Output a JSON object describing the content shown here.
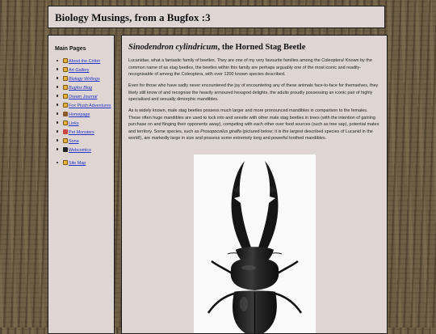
{
  "header": {
    "title": "Biology Musings, from a Bugfox :3"
  },
  "sidebar": {
    "heading": "Main Pages",
    "items": [
      {
        "label": "About the Critter",
        "icon": "bugfox-icon"
      },
      {
        "label": "Art Gallery",
        "icon": "bugfox-icon"
      },
      {
        "label": "Biology Writings",
        "icon": "bugfox-icon"
      },
      {
        "label": "Bugfox Blog",
        "icon": "bugfox-icon"
      },
      {
        "label": "Dream Journal",
        "icon": "bugfox-icon"
      },
      {
        "label": "Fox Plush Adventures",
        "icon": "bugfox-icon"
      },
      {
        "label": "Homepage",
        "icon": "house-icon"
      },
      {
        "label": "Links",
        "icon": "bugfox-icon"
      },
      {
        "label": "Pet Monsters",
        "icon": "pet-icon"
      },
      {
        "label": "Sona",
        "icon": "bugfox-icon"
      },
      {
        "label": "Webcomics",
        "icon": "comic-icon"
      }
    ],
    "sitemap_label": "Site Map"
  },
  "article": {
    "title_italic": "Sinodendron cylindricum",
    "title_rest": ", the Horned Stag Beetle",
    "p1": "Lucanidae, what a fantastic family of beetles. They are one of my very favourite families among the Coleoptera! Known by the common name of as stag beetles, the beetles within this family are perhaps arguably one of the most iconic and readily-recognisable of among the Coleoptera, with over 1200 known species described.",
    "p2": "Even for those who have sadly never encountered the joy of encountering any of these animals face-to-face for themselves, they likely still know of and recognise the heavily armoured hexapod delights, the adults proudly possessing an iconic pair of highly specialised and sexually dimorphic mandibles.",
    "p3_a": "As is widely known, male stag beetles possess much larger and more pronounced mandibles in comparison to the females. These often huge mandibles are used to lock into and wrestle with other male stag beetles in trees (with the intention of gaining purchase on and flinging their opponents away), competing with each other over food sources (such as tree sap), potential mates and territory. Some species, such as ",
    "p3_italic": "Prosopocoilus giraffa",
    "p3_b": " (pictured below; it is the largest described species of Lucanid in the world!), are markedly large in size and possess some extremely long and powerful toothed mandibles."
  },
  "colors": {
    "panel_bg": "#dfd6d3",
    "link": "#2233cc",
    "border": "#1b1b1b"
  }
}
